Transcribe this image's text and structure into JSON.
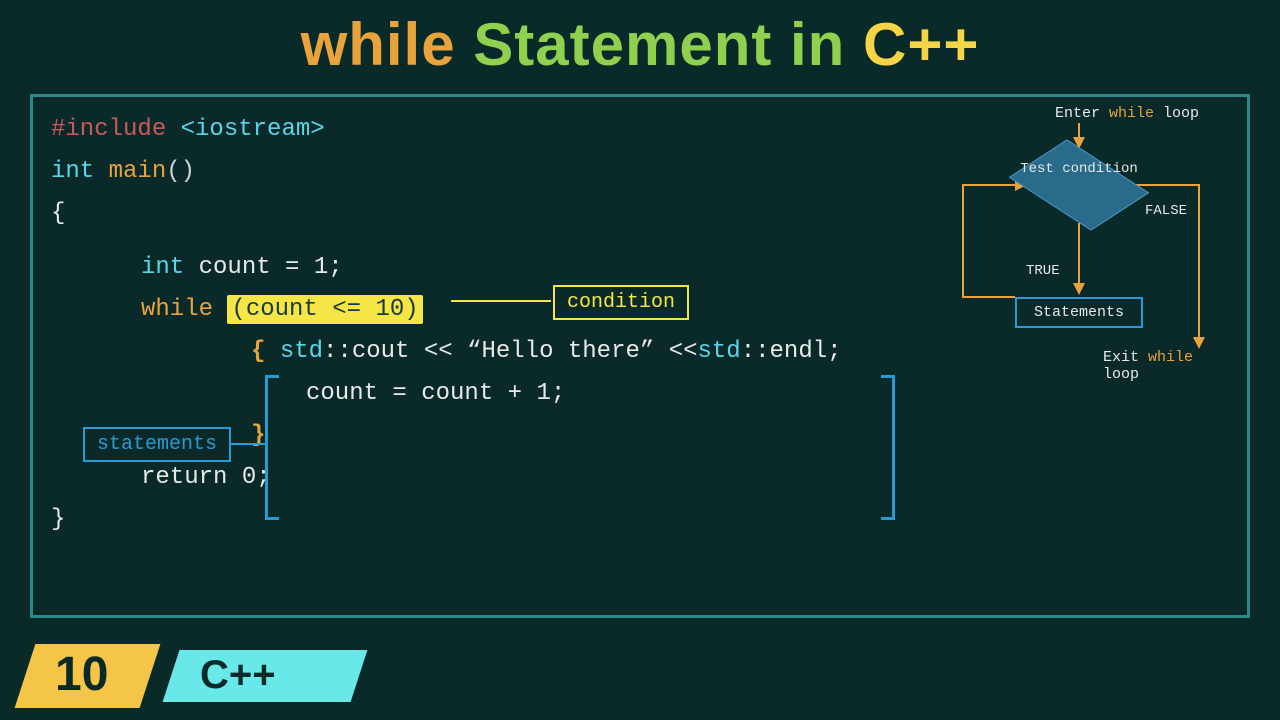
{
  "title": {
    "while": "while",
    "stmt": "Statement in",
    "cpp": "C++"
  },
  "code": {
    "include_kw": "#include",
    "include_lib": "<iostream>",
    "int_kw": "int",
    "main_fn": "main",
    "parens": "()",
    "open_brace": "{",
    "int_count": "int",
    "count_decl": "count = 1;",
    "while_kw": "while",
    "cond": "(count <= 10)",
    "body_open": "{",
    "std1": "std",
    "cout": "::cout << “Hello there” <<",
    "std2": "std",
    "endl": "::endl;",
    "count_inc": "count = count + 1;",
    "body_close": "}",
    "return": "return 0;",
    "close_brace": "}"
  },
  "labels": {
    "condition": "condition",
    "statements": "statements"
  },
  "flowchart": {
    "enter_pre": "Enter ",
    "enter_while": "while",
    "enter_post": " loop",
    "test": "Test condition",
    "true": "TRUE",
    "false": "FALSE",
    "statements": "Statements",
    "exit_pre": "Exit ",
    "exit_while": "while",
    "exit_post": " loop"
  },
  "footer": {
    "number": "10",
    "lang": "C++"
  }
}
